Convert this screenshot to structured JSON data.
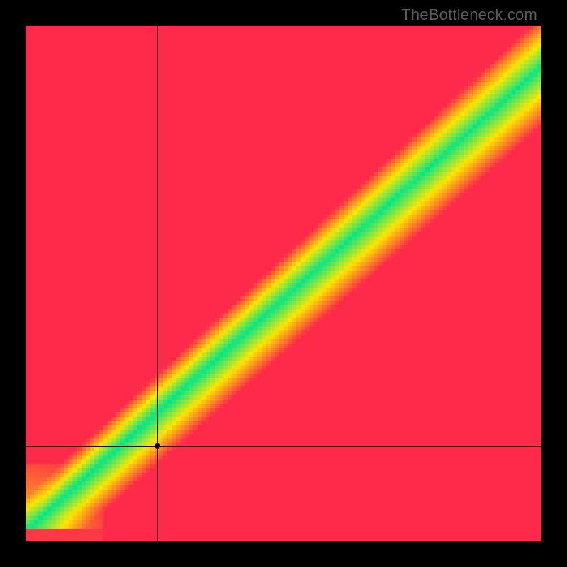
{
  "watermark": "TheBottleneck.com",
  "chart_data": {
    "type": "heatmap",
    "title": "",
    "xlabel": "",
    "ylabel": "",
    "xlim": [
      0,
      1
    ],
    "ylim": [
      0,
      1
    ],
    "grid_resolution": 120,
    "colorscale": "red-yellow-green",
    "ideal_band": {
      "slope": 0.9,
      "intercept": 0.02,
      "upper_offset_frac": 0.07,
      "lower_offset_frac": 0.1,
      "corner_widen_frac": 0.03
    },
    "marker": {
      "x": 0.255,
      "y": 0.185
    },
    "crosshair": {
      "x": 0.255,
      "y": 0.185
    }
  }
}
